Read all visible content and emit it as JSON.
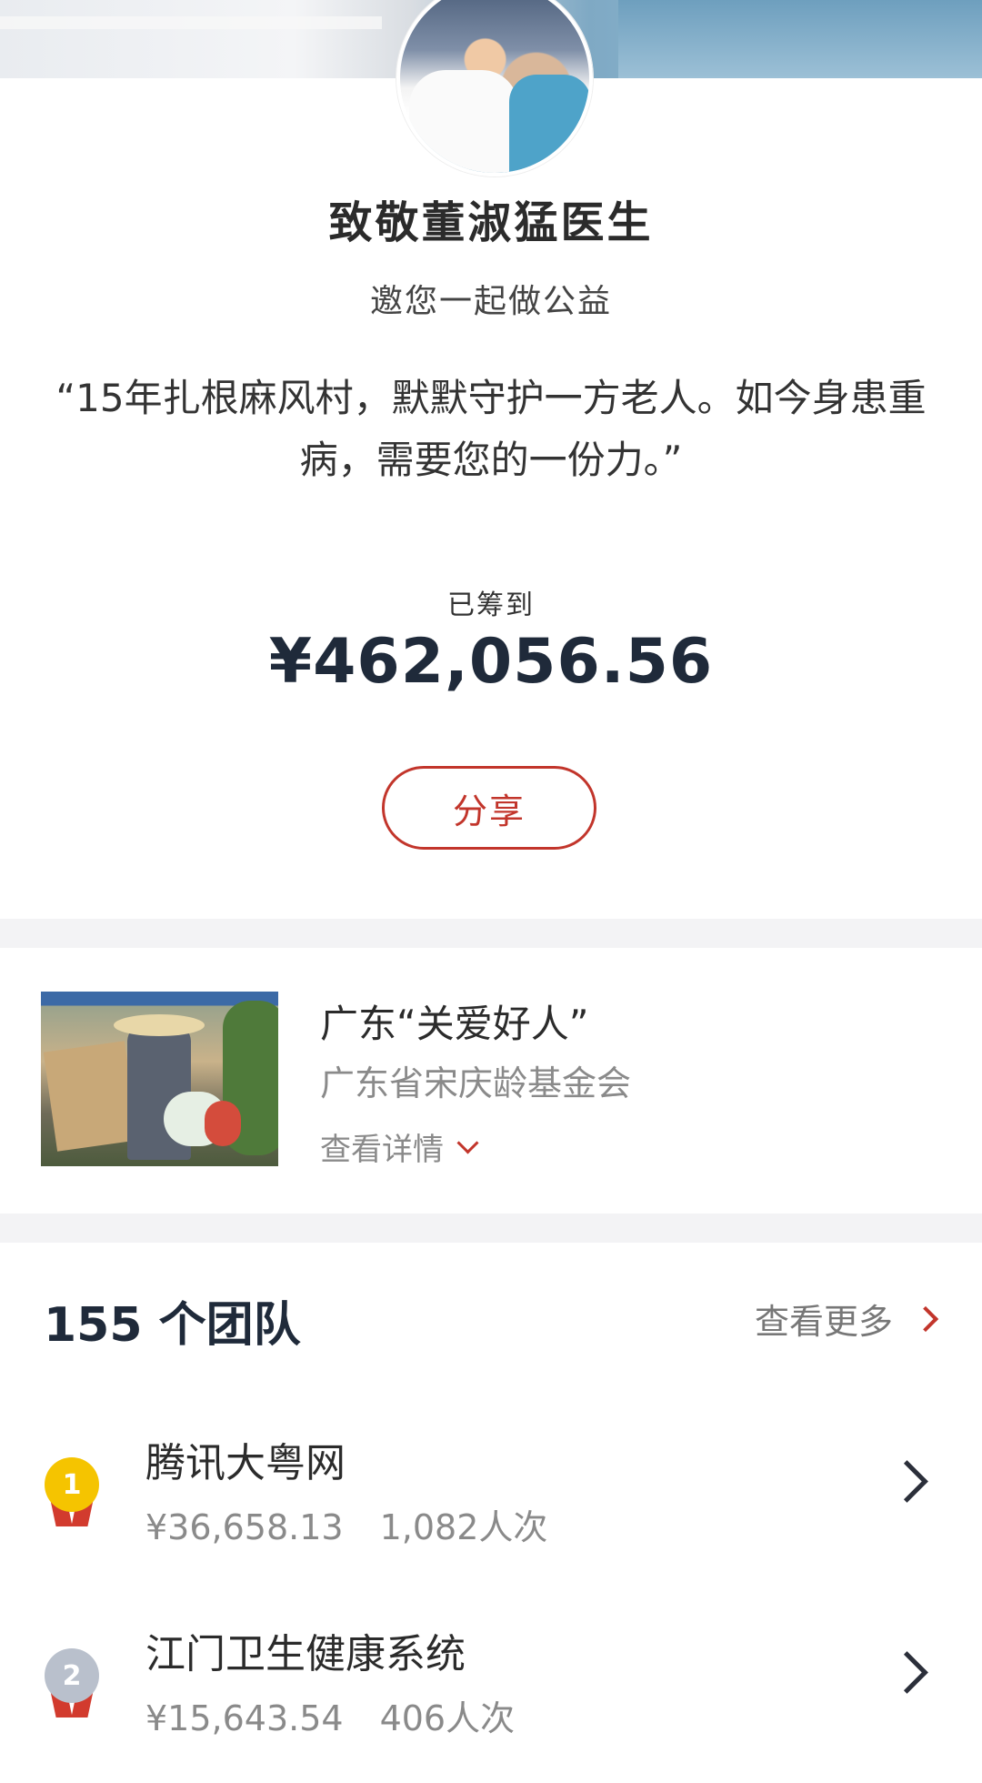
{
  "campaign": {
    "title": "致敬董淑猛医生",
    "subtitle": "邀您一起做公益",
    "quote": "“15年扎根麻风村，默默守护一方老人。如今身患重病，需要您的一份力。”",
    "raised_label": "已筹到",
    "raised_amount": "¥462,056.56",
    "share_label": "分享"
  },
  "project": {
    "title": "广东“关爱好人”",
    "organization": "广东省宋庆龄基金会",
    "detail_label": "查看详情"
  },
  "teams": {
    "count_label": "155 个团队",
    "view_more_label": "查看更多",
    "items": [
      {
        "rank": "1",
        "name": "腾讯大粤网",
        "amount": "¥36,658.13",
        "participants": "1,082人次",
        "medal_color": "#f5c400"
      },
      {
        "rank": "2",
        "name": "江门卫生健康系统",
        "amount": "¥15,643.54",
        "participants": "406人次",
        "medal_color": "#b9c0cc"
      }
    ]
  },
  "colors": {
    "accent": "#c2352b",
    "amount_text": "#1f2a3a",
    "divider": "#f3f3f5"
  }
}
